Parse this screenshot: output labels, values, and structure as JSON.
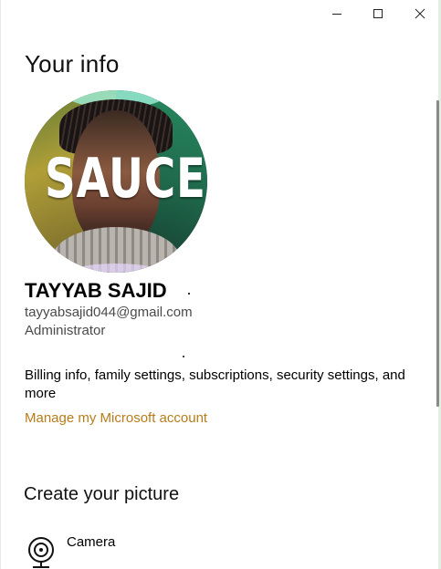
{
  "window": {
    "controls": {
      "minimize_icon": "minimize-icon",
      "maximize_icon": "maximize-icon",
      "close_icon": "close-icon"
    }
  },
  "page": {
    "title": "Your info"
  },
  "profile": {
    "avatar_text": "SAUCE",
    "name": "TAYYAB SAJID",
    "email": "tayyabsajid044@gmail.com",
    "role": "Administrator",
    "billing_text": "Billing info, family settings, subscriptions, security settings, and more",
    "manage_link": "Manage my Microsoft account"
  },
  "create_picture": {
    "title": "Create your picture",
    "options": [
      {
        "label": "Camera",
        "icon": "camera-icon"
      }
    ]
  },
  "colors": {
    "link": "#b87c1a",
    "text": "#000000",
    "secondary_text": "#4a4a4a"
  }
}
